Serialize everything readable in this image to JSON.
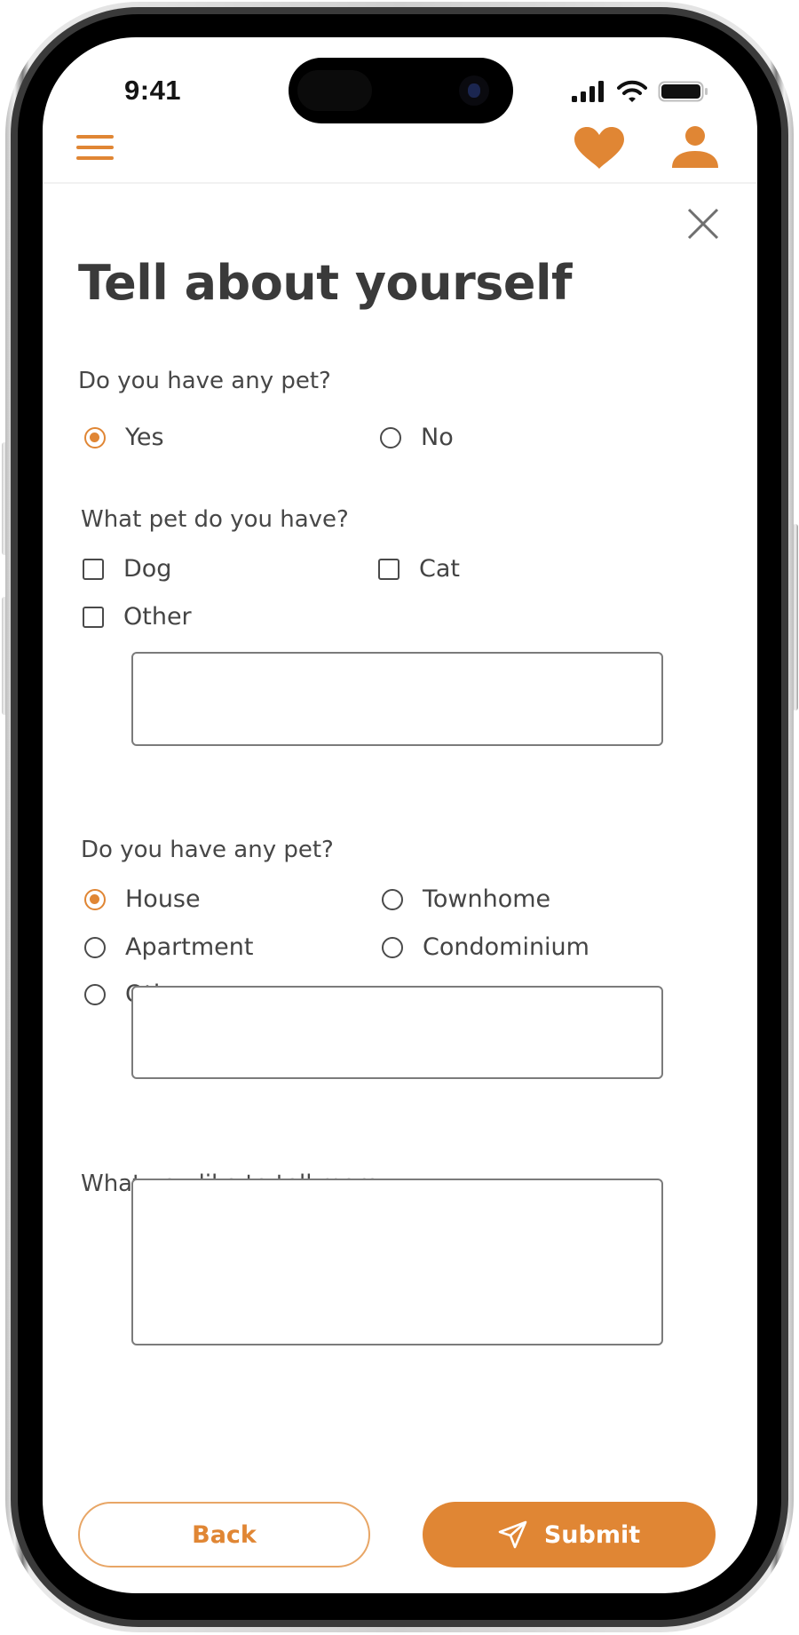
{
  "status_bar": {
    "time": "9:41",
    "icons": [
      "cellular-signal-icon",
      "wifi-icon",
      "battery-icon"
    ]
  },
  "header": {
    "menu_icon": "hamburger-menu-icon",
    "favorite_icon": "heart-icon",
    "profile_icon": "person-icon",
    "accent_color": "#E08634"
  },
  "dialog": {
    "close_icon": "close-icon",
    "title": "Tell about yourself"
  },
  "form": {
    "q1": {
      "label": "Do you have any pet?",
      "type": "radio",
      "options": [
        {
          "label": "Yes",
          "checked": true
        },
        {
          "label": "No",
          "checked": false
        }
      ]
    },
    "q2": {
      "label": "What pet do you have?",
      "type": "checkbox",
      "options": [
        {
          "label": "Dog",
          "checked": false
        },
        {
          "label": "Cat",
          "checked": false
        },
        {
          "label": "Other",
          "checked": false
        }
      ],
      "other_value": "",
      "other_placeholder": ""
    },
    "q3": {
      "label": "Do you have any pet?",
      "type": "radio",
      "options": [
        {
          "label": "House",
          "checked": true
        },
        {
          "label": "Townhome",
          "checked": false
        },
        {
          "label": "Apartment",
          "checked": false
        },
        {
          "label": "Condominium",
          "checked": false
        },
        {
          "label": "Other",
          "checked": false
        }
      ],
      "other_value": "",
      "other_placeholder": ""
    },
    "q4": {
      "label": "What you like to tell more",
      "value": "",
      "placeholder": ""
    }
  },
  "actions": {
    "back_label": "Back",
    "submit_label": "Submit",
    "submit_icon": "send-icon"
  }
}
